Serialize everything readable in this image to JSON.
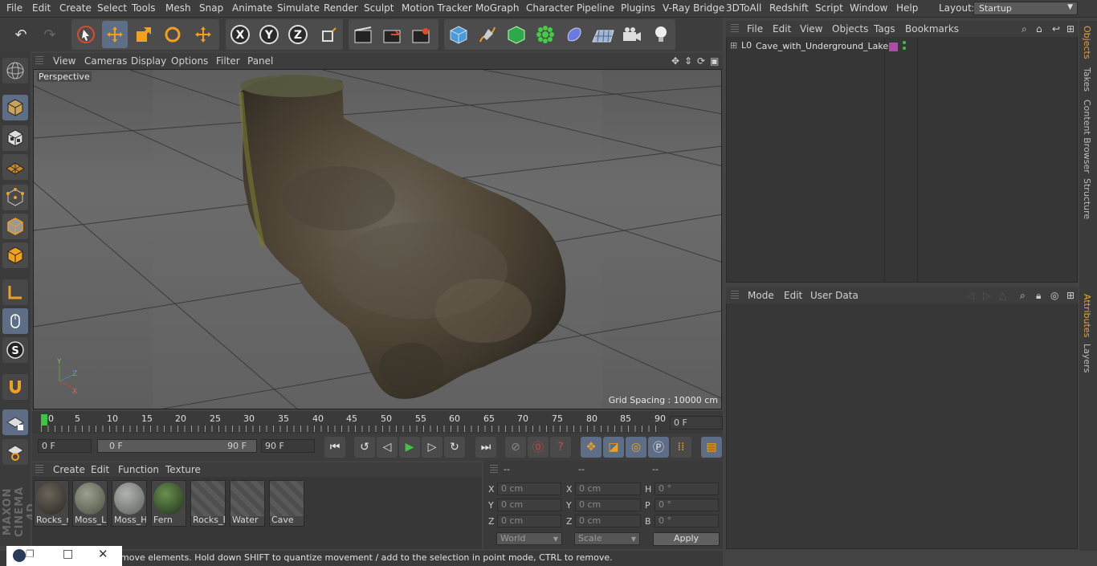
{
  "menubar": {
    "items": [
      "File",
      "Edit",
      "Create",
      "Select",
      "Tools",
      "Mesh",
      "Snap",
      "Animate",
      "Simulate",
      "Render",
      "Sculpt",
      "Motion Tracker",
      "MoGraph",
      "Character",
      "Pipeline",
      "Plugins",
      "V-Ray Bridge",
      "3DToAll",
      "Redshift",
      "Script",
      "Window",
      "Help"
    ],
    "layout_label": "Layout:",
    "layout_value": "Startup"
  },
  "viewport": {
    "menu": [
      "View",
      "Cameras",
      "Display",
      "Options",
      "Filter",
      "Panel"
    ],
    "camera_label": "Perspective",
    "grid_spacing": "Grid Spacing : 10000 cm"
  },
  "timeline": {
    "ticks": [
      "0",
      "5",
      "10",
      "15",
      "20",
      "25",
      "30",
      "35",
      "40",
      "45",
      "50",
      "55",
      "60",
      "65",
      "70",
      "75",
      "80",
      "85",
      "90"
    ],
    "current_frame": "0 F",
    "start_field": "0 F",
    "range_start": "0 F",
    "range_end": "90 F",
    "end_field": "90 F"
  },
  "materials": {
    "menu": [
      "Create",
      "Edit",
      "Function",
      "Texture"
    ],
    "items": [
      {
        "name": "Rocks_m",
        "swatch": "#3a3530"
      },
      {
        "name": "Moss_Lp",
        "swatch": "#6a7060"
      },
      {
        "name": "Moss_H",
        "swatch": "#808680"
      },
      {
        "name": "Fern",
        "swatch": "#3c5a30"
      },
      {
        "name": "Rocks_B",
        "swatch": ""
      },
      {
        "name": "Water",
        "swatch": ""
      },
      {
        "name": "Cave",
        "swatch": ""
      }
    ]
  },
  "coords": {
    "headers": [
      "--",
      "--",
      "--"
    ],
    "rows": [
      {
        "l1": "X",
        "v1": "0 cm",
        "l2": "X",
        "v2": "0 cm",
        "l3": "H",
        "v3": "0 °"
      },
      {
        "l1": "Y",
        "v1": "0 cm",
        "l2": "Y",
        "v2": "0 cm",
        "l3": "P",
        "v3": "0 °"
      },
      {
        "l1": "Z",
        "v1": "0 cm",
        "l2": "Z",
        "v2": "0 cm",
        "l3": "B",
        "v3": "0 °"
      }
    ],
    "world": "World",
    "scale": "Scale",
    "apply": "Apply"
  },
  "status": "move elements. Hold down SHIFT to quantize movement / add to the selection in point mode, CTRL to remove.",
  "objects": {
    "menu": [
      "File",
      "Edit",
      "View",
      "Objects",
      "Tags",
      "Bookmarks"
    ],
    "item_name": "Cave_with_Underground_Lake"
  },
  "attributes": {
    "menu": [
      "Mode",
      "Edit",
      "User Data"
    ]
  },
  "sidetabs": {
    "top": [
      "Objects",
      "Takes",
      "Content Browser",
      "Structure"
    ],
    "bottom": [
      "Attributes",
      "Layers"
    ]
  },
  "brand": "MAXON CINEMA 4D",
  "colors": {
    "accent": "#5e6e86",
    "active_tab": "#e6a23c",
    "play": "#3ec43e"
  }
}
